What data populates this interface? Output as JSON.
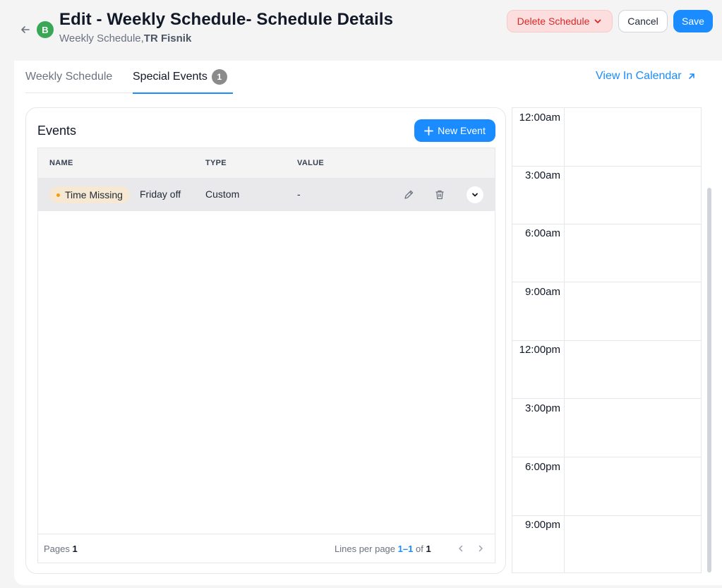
{
  "header": {
    "avatar_letter": "B",
    "title": "Edit - Weekly Schedule- Schedule Details",
    "subtitle_prefix": "Weekly Schedule,",
    "subtitle_bold": "TR Fisnik",
    "delete_label": "Delete Schedule",
    "cancel_label": "Cancel",
    "save_label": "Save"
  },
  "tabs": [
    {
      "label": "Weekly Schedule",
      "active": false
    },
    {
      "label": "Special Events",
      "badge": "1",
      "active": true
    }
  ],
  "view_calendar_label": "View In Calendar",
  "events": {
    "title": "Events",
    "new_event_label": "New Event",
    "columns": [
      "NAME",
      "TYPE",
      "VALUE"
    ],
    "rows": [
      {
        "status": "Time Missing",
        "name": "Friday off",
        "type": "Custom",
        "value": "-"
      }
    ],
    "footer": {
      "pages_label": "Pages",
      "pages_value": "1",
      "lines_label": "Lines per page",
      "range": "1–1",
      "of_label": "of",
      "total": "1"
    }
  },
  "calendar": {
    "times": [
      "12:00am",
      "3:00am",
      "6:00am",
      "9:00am",
      "12:00pm",
      "3:00pm",
      "6:00pm",
      "9:00pm"
    ]
  },
  "colors": {
    "accent": "#1a8cff",
    "delete_bg": "#fcdede",
    "delete_text": "#dc2626",
    "avatar": "#3aa757",
    "chip_bg": "#f6e8d2",
    "chip_dot": "#f59e0b"
  }
}
